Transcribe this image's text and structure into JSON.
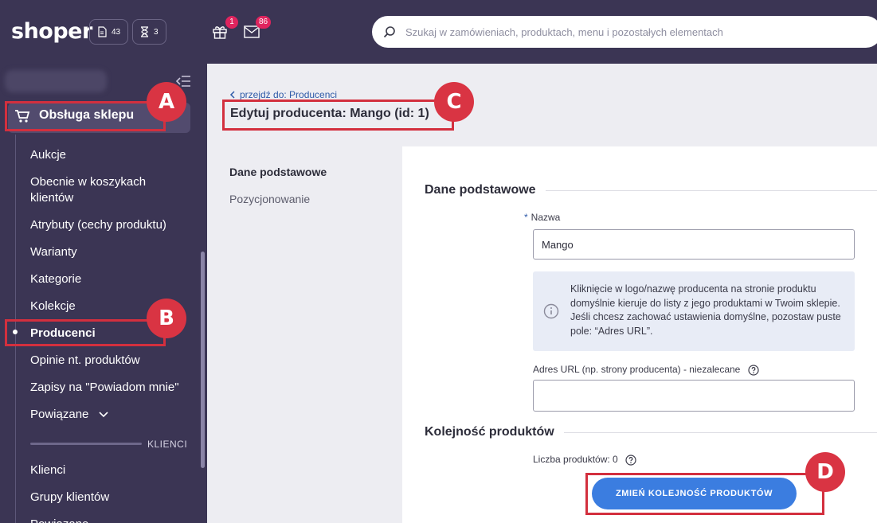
{
  "topbar": {
    "logo": "shoper",
    "orders_count": "43",
    "tasks_count": "3",
    "gift_badge": "1",
    "mail_badge": "86",
    "search_placeholder": "Szukaj w zamówieniach, produktach, menu i pozostałych elementach"
  },
  "sidebar": {
    "section_label": "Obsługa sklepu",
    "items": [
      "Aukcje",
      "Obecnie w koszykach klientów",
      "Atrybuty (cechy produktu)",
      "Warianty",
      "Kategorie",
      "Kolekcje",
      "Producenci",
      "Opinie nt. produktów",
      "Zapisy na \"Powiadom mnie\"",
      "Powiązane"
    ],
    "group_label": "KLIENCI",
    "group_items": [
      "Klienci",
      "Grupy klientów",
      "Powiązane"
    ]
  },
  "annotations": [
    "A",
    "B",
    "C",
    "D"
  ],
  "main": {
    "breadcrumb": "przejdź do: Producenci",
    "title": "Edytuj producenta: Mango (id: 1)",
    "subnav": [
      "Dane podstawowe",
      "Pozycjonowanie"
    ],
    "section1_title": "Dane podstawowe",
    "name_required": "*",
    "name_label": "Nazwa",
    "name_value": "Mango",
    "info_text": "Kliknięcie w logo/nazwę producenta na stronie produktu domyślnie kieruje do listy z jego produktami w Twoim sklepie. Jeśli chcesz zachować ustawienia domyślne, pozostaw puste pole: “Adres URL”.",
    "url_label": "Adres URL (np. strony producenta) - niezalecane",
    "url_value": "",
    "section2_title": "Kolejność produktów",
    "count_label": "Liczba produktów: 0",
    "change_order_button": "ZMIEŃ KOLEJNOŚĆ PRODUKTÓW"
  },
  "colors": {
    "sidebar_bg": "#3b3554",
    "accent_blue": "#3b7de0",
    "annotation_red": "#d32f3e",
    "badge_red": "#e0245e"
  }
}
